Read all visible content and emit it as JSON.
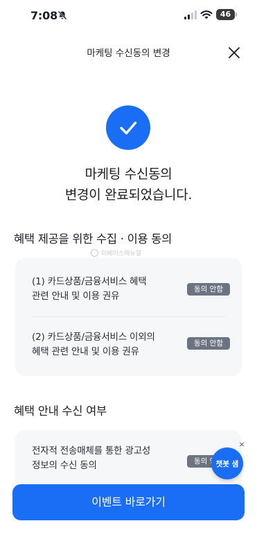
{
  "status_bar": {
    "time": "7:08",
    "battery": "46"
  },
  "nav": {
    "title": "마케팅 수신동의 변경"
  },
  "result": {
    "line1": "마케팅 수신동의",
    "line2": "변경이 완료되었습니다."
  },
  "watermark": "이베이스매뉴얼",
  "section1": {
    "title": "혜택 제공을 위한 수집 · 이용 동의",
    "items": [
      {
        "line1": "(1) 카드상품/금융서비스 혜택",
        "line2": "관련 안내 및 이용 권유",
        "badge": "동의 안함"
      },
      {
        "line1": "(2) 카드상품/금융서비스 이외의",
        "line2": "혜택 관련 안내 및 이용 권유",
        "badge": "동의 안함"
      }
    ]
  },
  "section2": {
    "title": "혜택 안내 수신 여부",
    "items": [
      {
        "line1": "전자적 전송매체를 통한 광고성",
        "line2": "정보의 수신 동의",
        "badge": "동의 안함"
      }
    ]
  },
  "chatbot": {
    "label": "챗봇 샘",
    "close": "×"
  },
  "cta": {
    "label": "이벤트 바로가기"
  },
  "colors": {
    "accent": "#1a6ef5",
    "badge": "#6b7480",
    "card": "#f6f7f9"
  }
}
